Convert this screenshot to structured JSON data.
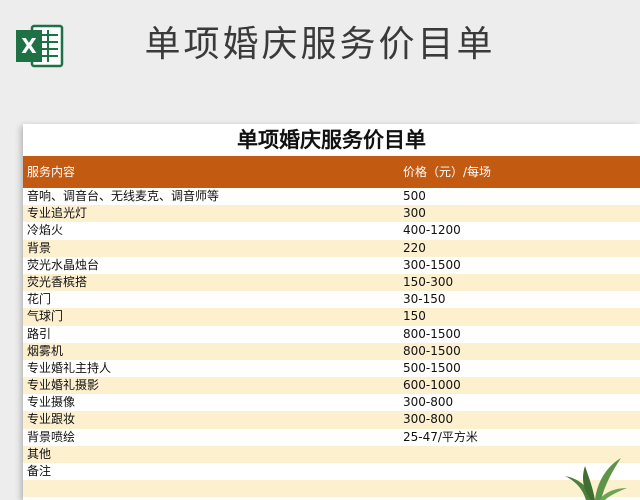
{
  "banner": {
    "title": "单项婚庆服务价目单",
    "icon": "excel-icon"
  },
  "sheet": {
    "title": "单项婚庆服务价目单",
    "columns": [
      "服务内容",
      "价格（元）/每场"
    ],
    "rows": [
      [
        "音响、调音台、无线麦克、调音师等",
        "500"
      ],
      [
        "专业追光灯",
        "300"
      ],
      [
        "冷焰火",
        "400-1200"
      ],
      [
        "背景",
        "220"
      ],
      [
        "荧光水晶烛台",
        "300-1500"
      ],
      [
        "荧光香槟搭",
        "150-300"
      ],
      [
        "花门",
        "30-150"
      ],
      [
        "气球门",
        "150"
      ],
      [
        "路引",
        "800-1500"
      ],
      [
        "烟雾机",
        "800-1500"
      ],
      [
        "专业婚礼主持人",
        "500-1500"
      ],
      [
        "专业婚礼摄影",
        "600-1000"
      ],
      [
        "专业摄像",
        "300-800"
      ],
      [
        "专业跟妆",
        "300-800"
      ],
      [
        "背景喷绘",
        "25-47/平方米"
      ],
      [
        "其他",
        ""
      ],
      [
        "备注",
        ""
      ],
      [
        "",
        ""
      ]
    ]
  },
  "colors": {
    "header_bg": "#c35a12",
    "alt_row_bg": "#fdf0cf",
    "excel_green": "#1e7145"
  }
}
